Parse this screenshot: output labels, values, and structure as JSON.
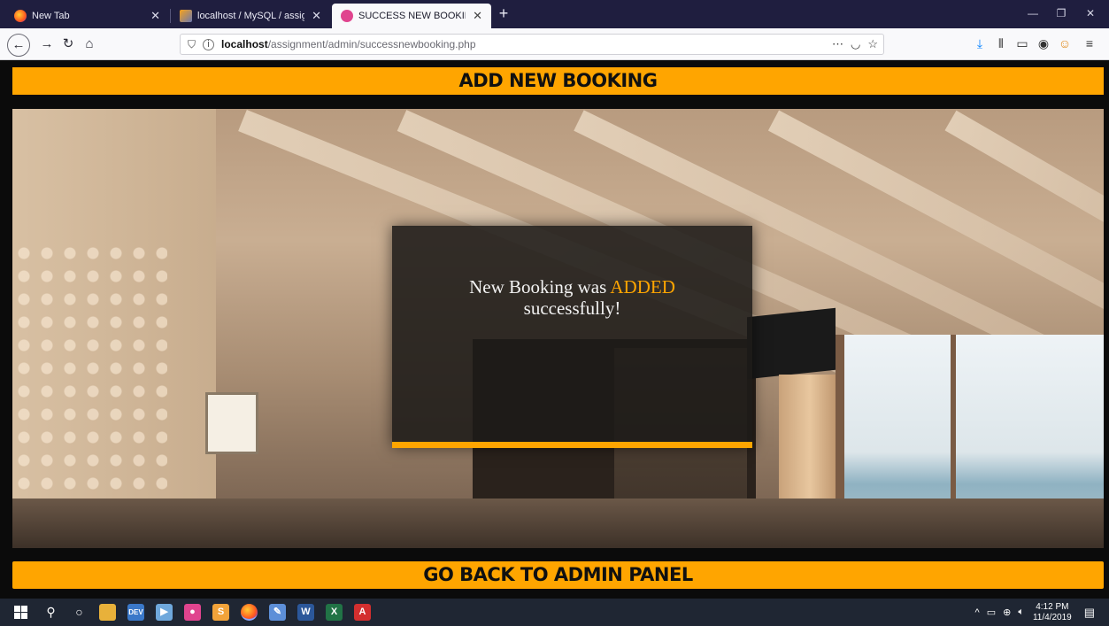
{
  "browser": {
    "tabs": [
      {
        "label": "New Tab",
        "active": false
      },
      {
        "label": "localhost / MySQL / assignment",
        "active": false
      },
      {
        "label": "SUCCESS NEW BOOKING",
        "active": true
      }
    ],
    "url_host": "localhost",
    "url_path": "/assignment/admin/successnewbooking.php"
  },
  "page": {
    "header": "ADD NEW BOOKING",
    "message_prefix": "New Booking was",
    "message_highlight": "ADDED",
    "message_suffix": "successfully!",
    "footer_button": "GO BACK TO ADMIN PANEL",
    "accent_color": "#ffa500"
  },
  "taskbar": {
    "time": "4:12 PM",
    "date": "11/4/2019"
  }
}
